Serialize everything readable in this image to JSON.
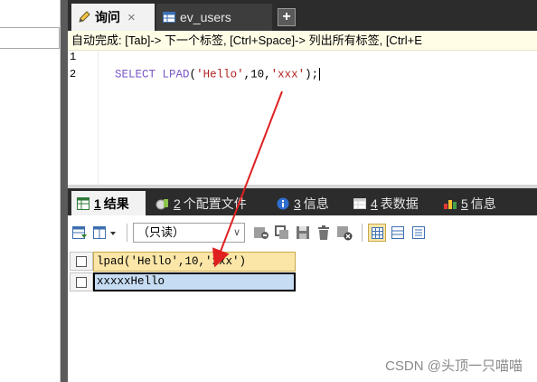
{
  "tabs": [
    {
      "label": "询问",
      "icon": "query-pencil-icon",
      "active": true
    },
    {
      "label": "ev_users",
      "icon": "table-icon",
      "active": false
    }
  ],
  "autocomplete_hint": "自动完成: [Tab]-> 下一个标签, [Ctrl+Space]-> 列出所有标签, [Ctrl+E",
  "editor": {
    "line_numbers": [
      "1",
      "2"
    ],
    "code": {
      "keyword": "SELECT",
      "function": "LPAD",
      "open": "(",
      "arg1": "'Hello'",
      "comma1": ",",
      "arg2": "10",
      "comma2": ",",
      "arg3": "'xxx'",
      "close": ");"
    }
  },
  "result_tabs": [
    {
      "num": "1",
      "label": "结果",
      "icon": "results-grid-icon"
    },
    {
      "num": "2",
      "label": "个配置文件",
      "icon": "profile-icon"
    },
    {
      "num": "3",
      "label": "信息",
      "icon": "info-icon"
    },
    {
      "num": "4",
      "label": "表数据",
      "icon": "table-data-icon"
    },
    {
      "num": "5",
      "label": "信息",
      "icon": "history-icon"
    }
  ],
  "toolbar": {
    "readonly_label": "（只读）"
  },
  "grid": {
    "column_header": "lpad('Hello',10,'xxx')",
    "rows": [
      [
        "xxxxxHello"
      ]
    ]
  },
  "watermark": "CSDN @头顶一只喵喵",
  "colors": {
    "tab_bar_bg": "#2c2c2c",
    "hint_bg": "#fffde6",
    "keyword": "#7b57c6",
    "string": "#b22222",
    "header_bg": "#fbe6a8",
    "cell_bg": "#c6dcf2",
    "arrow": "#e02020"
  }
}
